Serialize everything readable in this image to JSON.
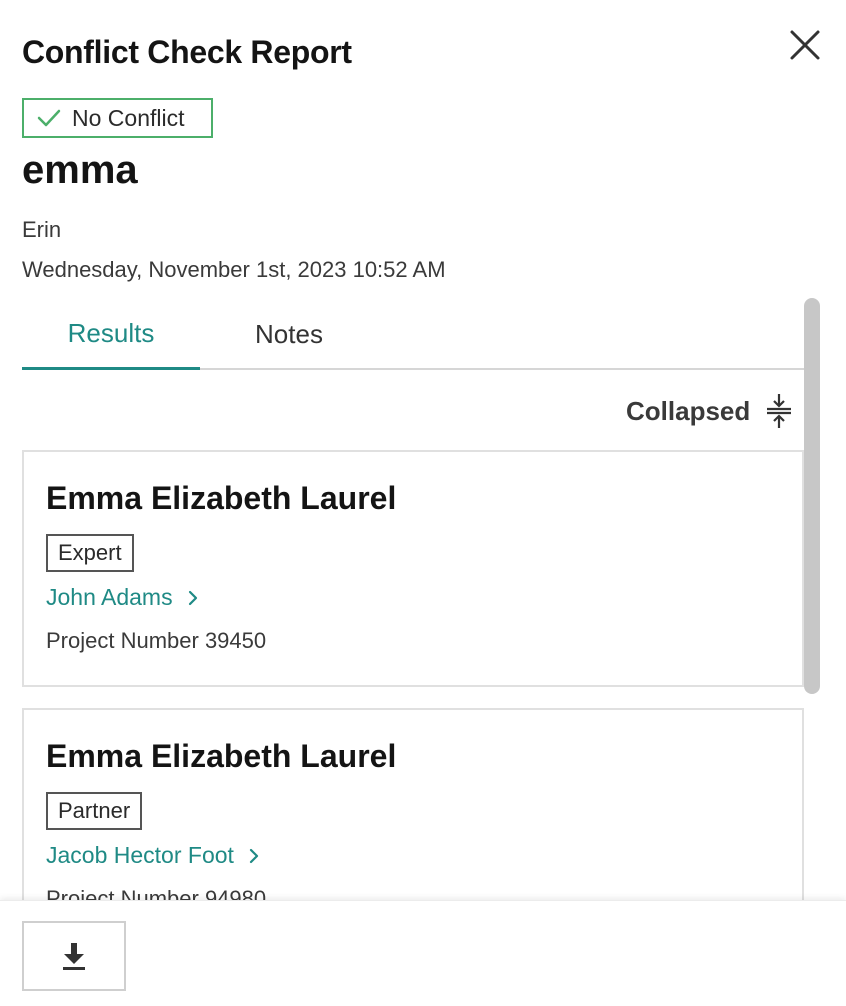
{
  "header": {
    "title": "Conflict Check Report",
    "close_icon": "close-icon"
  },
  "status": {
    "label": "No Conflict",
    "icon": "check-icon",
    "color": "#4caf6a"
  },
  "search": {
    "query": "emma",
    "user": "Erin",
    "datetime": "Wednesday, November 1st, 2023 10:52 AM"
  },
  "tabs": [
    {
      "label": "Results",
      "active": true
    },
    {
      "label": "Notes",
      "active": false
    }
  ],
  "results": {
    "toggle_label": "Collapsed",
    "toggle_icon": "collapse-icon",
    "items": [
      {
        "name": "Emma Elizabeth Laurel",
        "role": "Expert",
        "contact": "John Adams",
        "project": "Project Number 39450"
      },
      {
        "name": "Emma Elizabeth Laurel",
        "role": "Partner",
        "contact": "Jacob Hector Foot",
        "project": "Project Number 94980"
      }
    ]
  },
  "footer": {
    "download_icon": "download-icon"
  },
  "colors": {
    "accent": "#1f8a85",
    "success": "#4caf6a",
    "text": "#141414",
    "muted": "#3a3a3a",
    "border": "#e0e0e0"
  }
}
